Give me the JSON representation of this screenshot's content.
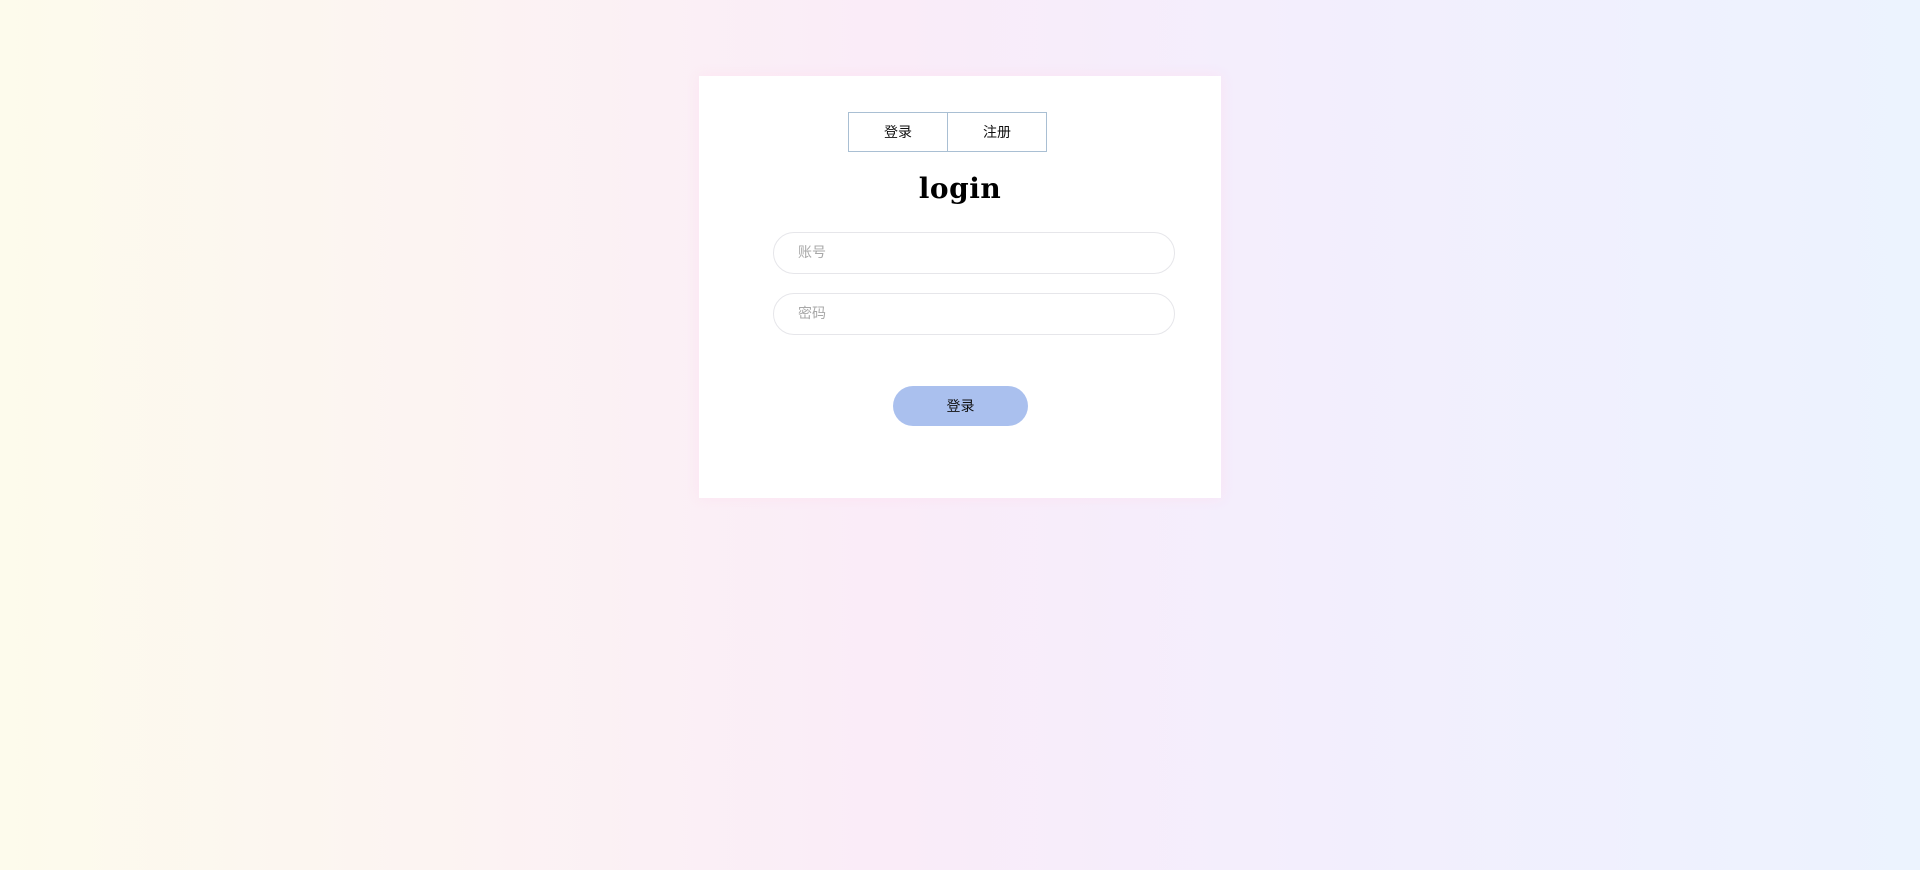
{
  "tabs": [
    {
      "label": "登录"
    },
    {
      "label": "注册"
    }
  ],
  "form": {
    "title": "login",
    "account_placeholder": "账号",
    "password_placeholder": "密码",
    "submit_label": "登录"
  },
  "colors": {
    "submit_button": "#aac0ee",
    "tab_border": "#a9bfd3"
  }
}
